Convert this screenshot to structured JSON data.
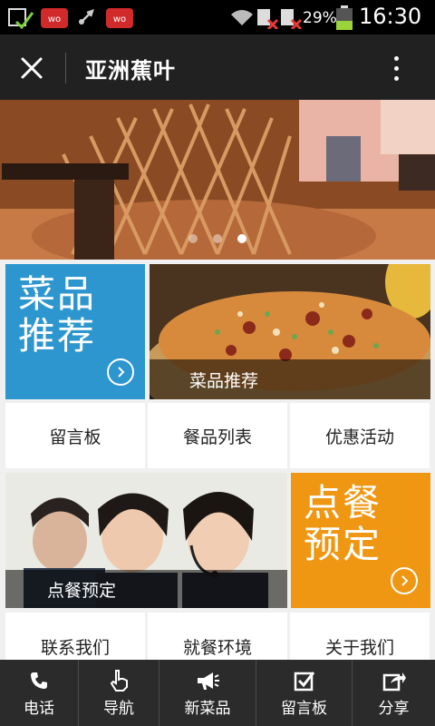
{
  "status_bar": {
    "battery_percent": "29%",
    "time": "16:30",
    "icons": [
      "photo-check-icon",
      "wo-app-icon",
      "usb-icon",
      "wo-app-icon",
      "wifi-icon",
      "sim1-no-signal-icon",
      "sim2-no-signal-icon",
      "battery-icon"
    ]
  },
  "header": {
    "title": "亚洲蕉叶",
    "close_icon": "close-icon",
    "more_icon": "more-vertical-icon"
  },
  "banner": {
    "slide_count": 3,
    "active_slide": 3
  },
  "tiles": {
    "dishes_big": "菜品\n推荐",
    "dishes_caption": "菜品推荐",
    "message_board": "留言板",
    "menu_list": "餐品列表",
    "promotions": "优惠活动",
    "order_caption": "点餐预定",
    "order_big": "点餐\n预定",
    "contact": "联系我们",
    "environment": "就餐环境",
    "about": "关于我们"
  },
  "bottom_nav": [
    {
      "label": "电话",
      "icon": "phone-icon"
    },
    {
      "label": "导航",
      "icon": "hand-pointer-icon"
    },
    {
      "label": "新菜品",
      "icon": "megaphone-icon"
    },
    {
      "label": "留言板",
      "icon": "checkbox-icon"
    },
    {
      "label": "分享",
      "icon": "share-icon"
    }
  ],
  "colors": {
    "accent_blue": "#2d96cf",
    "accent_orange": "#ef9712",
    "header_bg": "#212121",
    "bottom_bar_bg": "#2b2b2b"
  }
}
